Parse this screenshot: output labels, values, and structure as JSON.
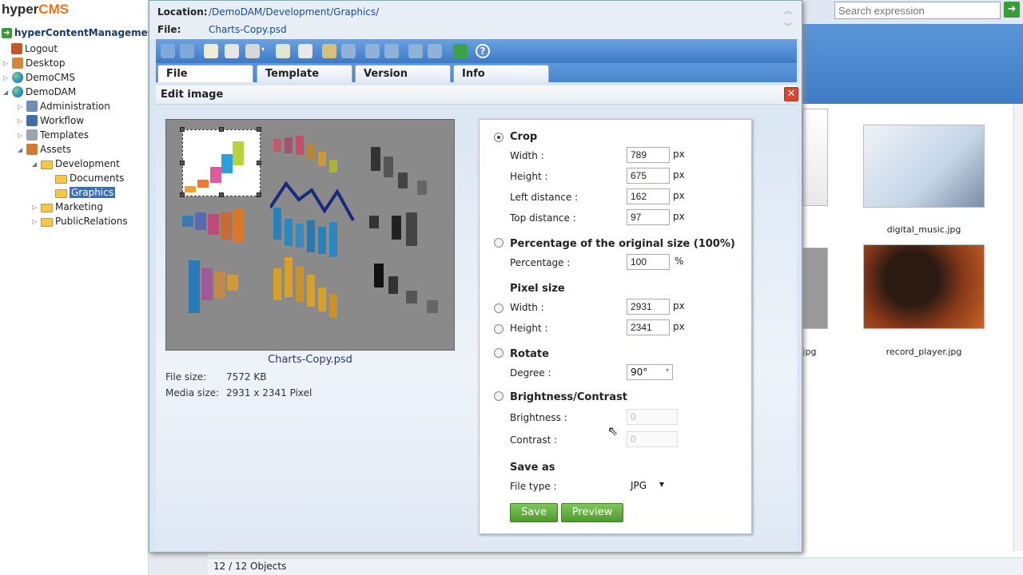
{
  "app": {
    "logo_main": "hyper",
    "logo_accent": "CMS",
    "tree_title": "hyperContentManagement"
  },
  "tree": [
    {
      "label": "Logout",
      "icon": "logout-icon"
    },
    {
      "label": "Desktop",
      "icon": "desktop-icon"
    },
    {
      "label": "DemoCMS",
      "icon": "globe-icon"
    },
    {
      "label": "DemoDAM",
      "icon": "globe-icon"
    },
    {
      "label": "Administration",
      "icon": "administration-icon"
    },
    {
      "label": "Workflow",
      "icon": "workflow-icon"
    },
    {
      "label": "Templates",
      "icon": "templates-icon"
    },
    {
      "label": "Assets",
      "icon": "assets-icon"
    },
    {
      "label": "Development",
      "icon": "folder-icon"
    },
    {
      "label": "Documents",
      "icon": "folder-icon"
    },
    {
      "label": "Graphics",
      "icon": "folder-icon"
    },
    {
      "label": "Marketing",
      "icon": "folder-icon"
    },
    {
      "label": "PublicRelations",
      "icon": "folder-icon"
    }
  ],
  "search": {
    "placeholder": "Search expression"
  },
  "files": [
    {
      "name": "digital_music.jpg"
    },
    {
      "name": "record_player.jpg"
    },
    {
      "name": "jpg"
    }
  ],
  "status": {
    "count": "12 / 12 Objects"
  },
  "dialog": {
    "location_label": "Location:",
    "location_value": "/DemoDAM/Development/Graphics/",
    "file_label": "File:",
    "file_value": "Charts-Copy.psd",
    "tabs": [
      "File",
      "Template",
      "Version",
      "Info"
    ],
    "edit_title": "Edit image",
    "preview_caption": "Charts-Copy.psd",
    "file_size_label": "File size:",
    "file_size_value": "7572 KB",
    "media_size_label": "Media size:",
    "media_size_value": "2931 x 2341 Pixel"
  },
  "form": {
    "crop": {
      "title": "Crop",
      "width_label": "Width :",
      "width": "789",
      "height_label": "Height :",
      "height": "675",
      "left_label": "Left distance :",
      "left": "162",
      "top_label": "Top distance :",
      "top": "97",
      "unit": "px"
    },
    "percentage": {
      "title": "Percentage of the original size (100%)",
      "label": "Percentage :",
      "value": "100",
      "unit": "%"
    },
    "pixel": {
      "title": "Pixel size",
      "width_label": "Width :",
      "width": "2931",
      "height_label": "Height :",
      "height": "2341",
      "unit": "px"
    },
    "rotate": {
      "title": "Rotate",
      "degree_label": "Degree :",
      "degree": "90°"
    },
    "brightness": {
      "title": "Brightness/Contrast",
      "brightness_label": "Brightness :",
      "brightness": "0",
      "contrast_label": "Contrast :",
      "contrast": "0"
    },
    "saveas": {
      "title": "Save as",
      "type_label": "File type :",
      "type": "JPG"
    },
    "buttons": {
      "save": "Save",
      "preview": "Preview"
    }
  }
}
